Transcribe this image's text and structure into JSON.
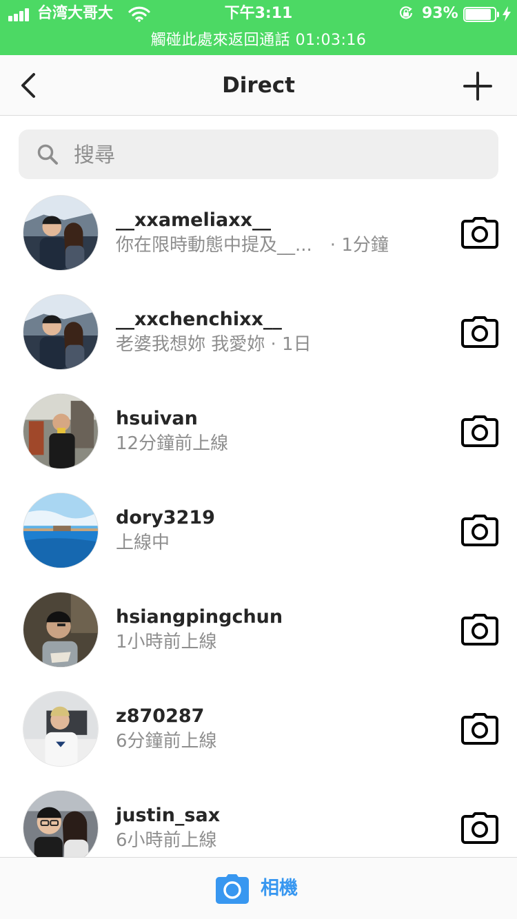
{
  "status_bar": {
    "carrier": "台湾大哥大",
    "time": "下午3:11",
    "battery_percent": "93%",
    "battery_level": 0.93,
    "signal_bars": 4,
    "call_banner": "觸碰此處來返回通話 01:03:16",
    "background_color": "#4cd964"
  },
  "nav": {
    "title": "Direct",
    "back_icon": "chevron-left-icon",
    "new_icon": "plus-icon"
  },
  "search": {
    "placeholder": "搜尋",
    "value": ""
  },
  "threads": [
    {
      "username": "__xxameliaxx__",
      "subtext": "你在限時動態中提及__...　· 1分鐘",
      "avatar": "couple-photo"
    },
    {
      "username": "__xxchenchixx__",
      "subtext": "老婆我想妳 我愛妳 · 1日",
      "avatar": "couple-photo"
    },
    {
      "username": "hsuivan",
      "subtext": "12分鐘前上線",
      "avatar": "street-photo"
    },
    {
      "username": "dory3219",
      "subtext": "上線中",
      "avatar": "pool-photo"
    },
    {
      "username": "hsiangpingchun",
      "subtext": "1小時前上線",
      "avatar": "portrait-photo"
    },
    {
      "username": "z870287",
      "subtext": "6分鐘前上線",
      "avatar": "room-photo"
    },
    {
      "username": "justin_sax",
      "subtext": "6小時前上線",
      "avatar": "selfie-photo"
    }
  ],
  "bottom_bar": {
    "label": "相機",
    "icon": "camera-icon",
    "accent_color": "#3897f0"
  }
}
